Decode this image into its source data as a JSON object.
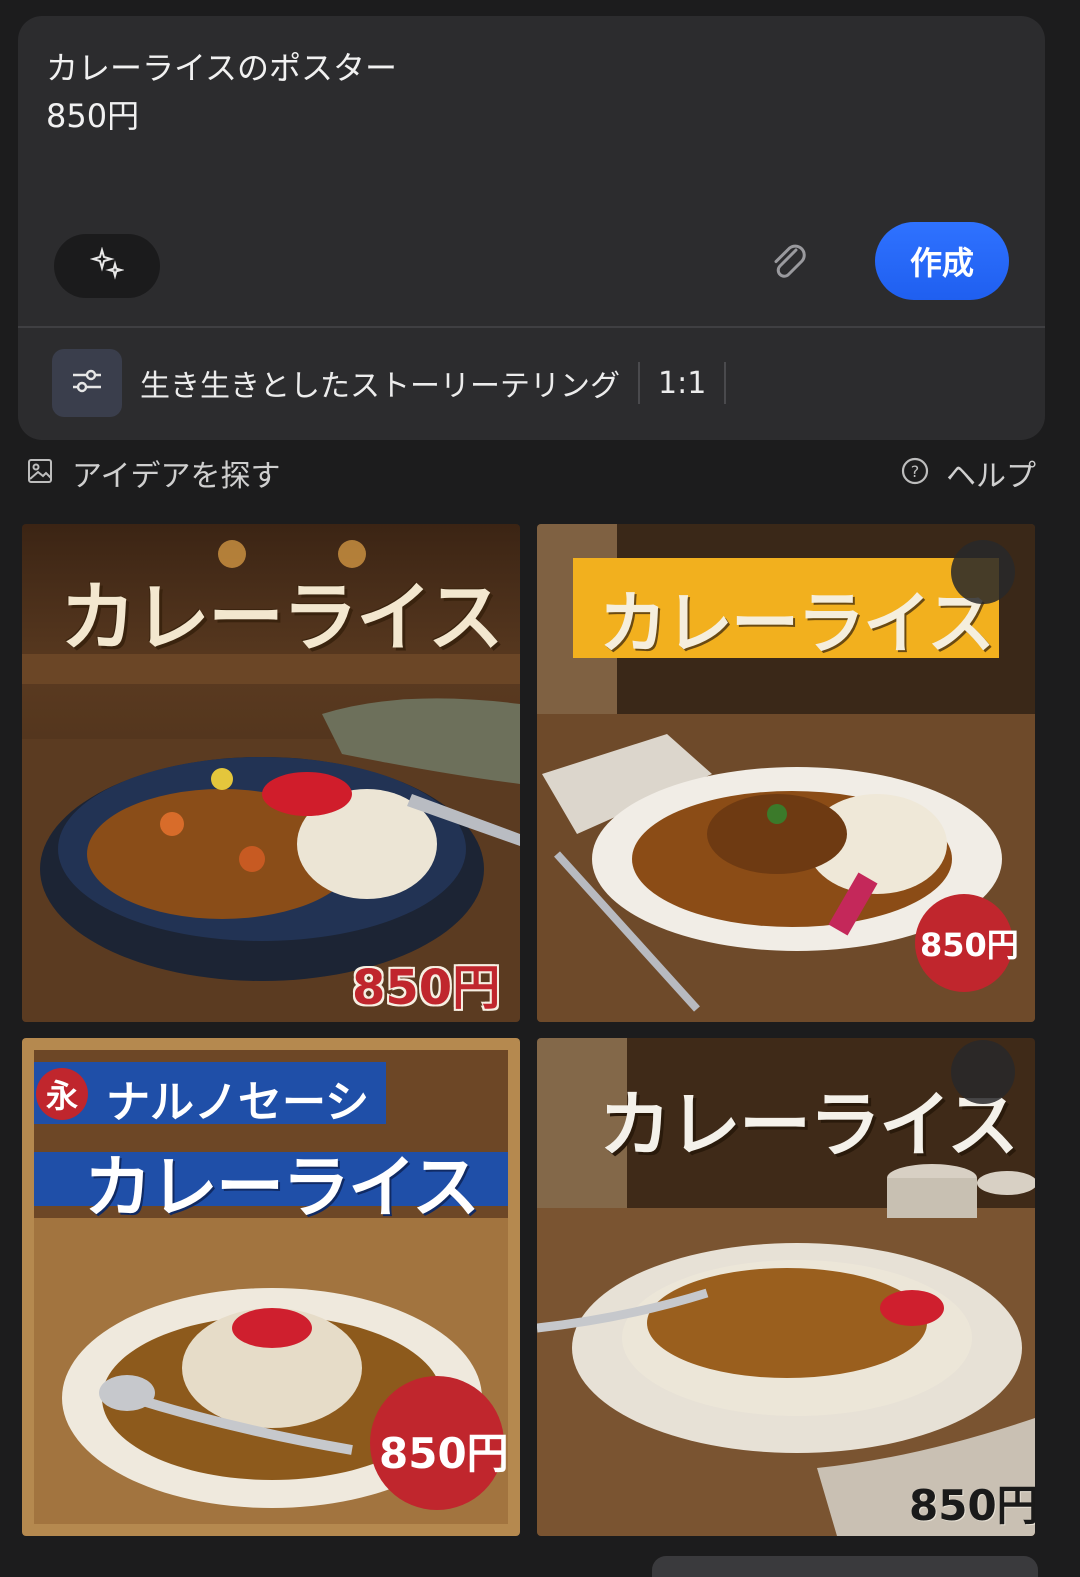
{
  "prompt": {
    "text": "カレーライスのポスター\n850円",
    "create_label": "作成",
    "style_label": "生き生きとしたストーリーテリング",
    "ratio_label": "1:1"
  },
  "ideas": {
    "label": "アイデアを探す",
    "help_label": "ヘルプ"
  },
  "results": [
    {
      "title": "カレーライス",
      "price": "850円"
    },
    {
      "title": "カレーライス",
      "price": "850円"
    },
    {
      "title": "カレーライス",
      "subtitle": "ナルノセーシ",
      "badge": "永",
      "price": "850円"
    },
    {
      "title": "カレーライス",
      "price": "850円"
    }
  ],
  "colors": {
    "accent_blue": "#2f72ff",
    "price_red": "#c0262d",
    "banner_yellow": "#f2b01e",
    "banner_blue": "#1f4fa8"
  }
}
